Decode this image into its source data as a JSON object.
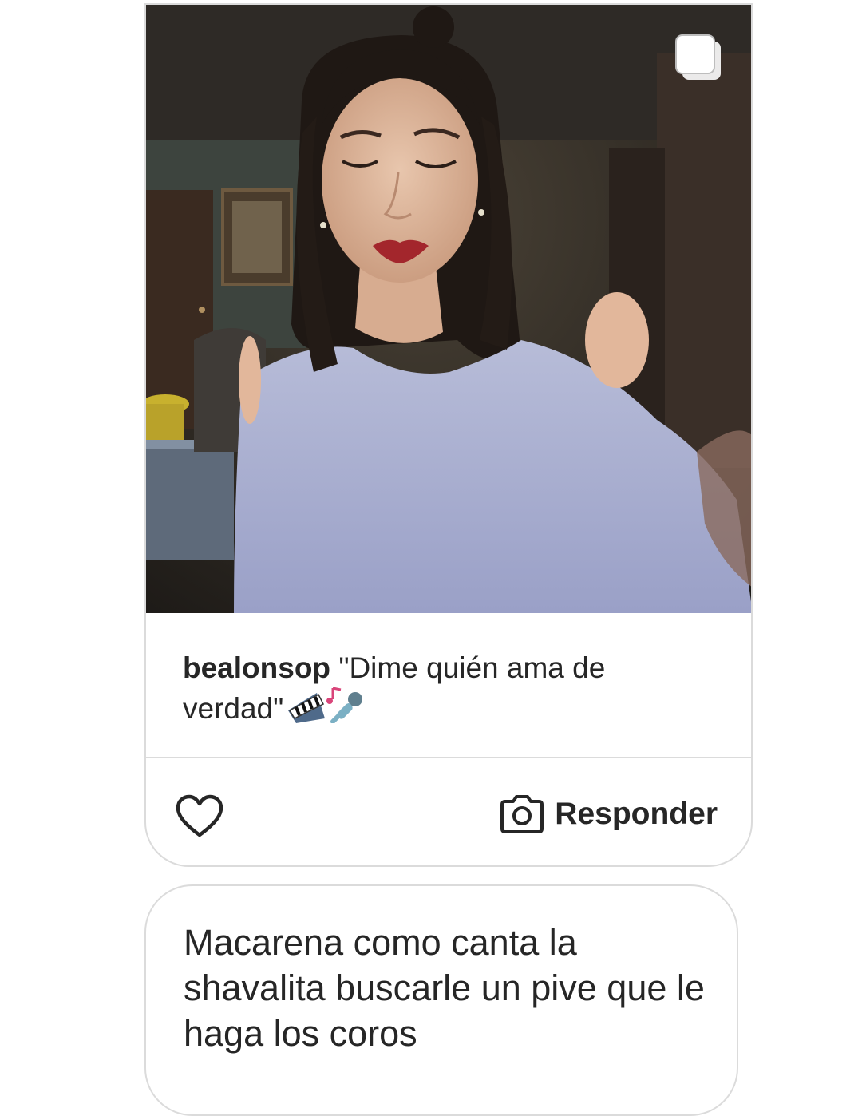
{
  "post": {
    "username": "bealonsop",
    "caption": "\"Dime quién ama de verdad\"",
    "caption_emojis": [
      "musical-keyboard",
      "musical-note",
      "microphone"
    ],
    "image_alt": "Woman with dark shoulder-length hair and red lipstick wearing a lavender cold-shoulder top in a dim room",
    "multi_icon": "carousel-icon"
  },
  "actions": {
    "like_icon": "heart-icon",
    "reply_icon": "camera-icon",
    "reply_label": "Responder"
  },
  "reply": {
    "text": "Macarena como canta la shavalita buscarle un pive que le haga los coros"
  },
  "colors": {
    "text": "#262626",
    "border": "#dbdbdb",
    "background": "#ffffff"
  }
}
